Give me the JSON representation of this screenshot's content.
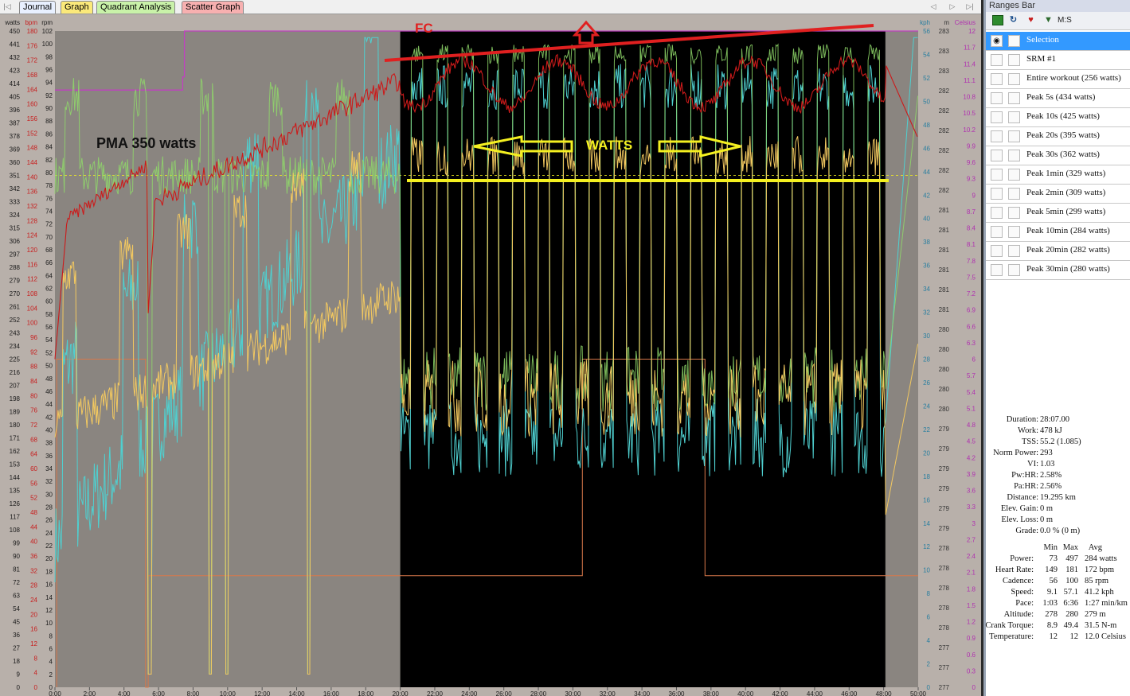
{
  "tabs": [
    "Journal",
    "Graph",
    "Quadrant Analysis",
    "Scatter Graph"
  ],
  "active_tab": "Graph",
  "nav_glyphs": [
    "|◁",
    "◁",
    "▷",
    "▷|"
  ],
  "axes": {
    "watts": {
      "label": "watts",
      "ticks": [
        "450",
        "441",
        "432",
        "423",
        "414",
        "405",
        "396",
        "387",
        "378",
        "369",
        "360",
        "351",
        "342",
        "333",
        "324",
        "315",
        "306",
        "297",
        "288",
        "279",
        "270",
        "261",
        "252",
        "243",
        "234",
        "225",
        "216",
        "207",
        "198",
        "189",
        "180",
        "171",
        "162",
        "153",
        "144",
        "135",
        "126",
        "117",
        "108",
        "99",
        "90",
        "81",
        "72",
        "63",
        "54",
        "45",
        "36",
        "27",
        "18",
        "9",
        "0"
      ]
    },
    "bpm": {
      "label": "bpm",
      "ticks": [
        "180",
        "176",
        "172",
        "168",
        "164",
        "160",
        "156",
        "152",
        "148",
        "144",
        "140",
        "136",
        "132",
        "128",
        "124",
        "120",
        "116",
        "112",
        "108",
        "104",
        "100",
        "96",
        "92",
        "88",
        "84",
        "80",
        "76",
        "72",
        "68",
        "64",
        "60",
        "56",
        "52",
        "48",
        "44",
        "40",
        "36",
        "32",
        "28",
        "24",
        "20",
        "16",
        "12",
        "8",
        "4",
        "0"
      ]
    },
    "rpm": {
      "label": "rpm",
      "ticks": [
        "102",
        "100",
        "98",
        "96",
        "94",
        "92",
        "90",
        "88",
        "86",
        "84",
        "82",
        "80",
        "78",
        "76",
        "74",
        "72",
        "70",
        "68",
        "66",
        "64",
        "62",
        "60",
        "58",
        "56",
        "54",
        "52",
        "50",
        "48",
        "46",
        "44",
        "42",
        "40",
        "38",
        "36",
        "34",
        "32",
        "30",
        "28",
        "26",
        "24",
        "22",
        "20",
        "18",
        "16",
        "14",
        "12",
        "10",
        "8",
        "6",
        "4",
        "2",
        "0"
      ]
    },
    "kph": {
      "label": "kph",
      "ticks": [
        "56",
        "54",
        "52",
        "50",
        "48",
        "46",
        "44",
        "42",
        "40",
        "38",
        "36",
        "34",
        "32",
        "30",
        "28",
        "26",
        "24",
        "22",
        "20",
        "18",
        "16",
        "14",
        "12",
        "10",
        "8",
        "6",
        "4",
        "2",
        "0"
      ]
    },
    "m": {
      "label": "m",
      "ticks": [
        "283",
        "283",
        "283",
        "282",
        "282",
        "282",
        "282",
        "282",
        "282",
        "281",
        "281",
        "281",
        "281",
        "281",
        "281",
        "280",
        "280",
        "280",
        "280",
        "280",
        "279",
        "279",
        "279",
        "279",
        "279",
        "279",
        "278",
        "278",
        "278",
        "278",
        "278",
        "277",
        "277",
        "277"
      ]
    },
    "celsius": {
      "label": "Celsius",
      "ticks": [
        "12",
        "11.7",
        "11.4",
        "11.1",
        "10.8",
        "10.5",
        "10.2",
        "9.9",
        "9.6",
        "9.3",
        "9",
        "8.7",
        "8.4",
        "8.1",
        "7.8",
        "7.5",
        "7.2",
        "6.9",
        "6.6",
        "6.3",
        "6",
        "5.7",
        "5.4",
        "5.1",
        "4.8",
        "4.5",
        "4.2",
        "3.9",
        "3.6",
        "3.3",
        "3",
        "2.7",
        "2.4",
        "2.1",
        "1.8",
        "1.5",
        "1.2",
        "0.9",
        "0.6",
        "0.3",
        "0"
      ]
    },
    "time": {
      "ticks": [
        "0:00",
        "2:00",
        "4:00",
        "6:00",
        "8:00",
        "10:00",
        "12:00",
        "14:00",
        "16:00",
        "18:00",
        "20:00",
        "22:00",
        "24:00",
        "26:00",
        "28:00",
        "30:00",
        "32:00",
        "34:00",
        "36:00",
        "38:00",
        "40:00",
        "42:00",
        "44:00",
        "46:00",
        "48:00",
        "50:00"
      ]
    }
  },
  "annotations": {
    "fc": "FC",
    "watts": "WATTS",
    "pma": "PMA 350 watts"
  },
  "chart_colors": {
    "heart_rate": "#cc1a1a",
    "speed": "#4fd0d0",
    "cadence": "#8fd86a",
    "power": "#f2c860",
    "altitude": "#d8784a",
    "temperature": "#c040c0",
    "annotation_red": "#e02020",
    "annotation_yellow": "#f4f020"
  },
  "ranges_bar": {
    "title": "Ranges Bar",
    "toolbar_label": "M:S",
    "items": [
      "Selection",
      "SRM #1",
      "Entire workout (256 watts)",
      "Peak 5s (434 watts)",
      "Peak 10s (425 watts)",
      "Peak 20s (395 watts)",
      "Peak 30s (362 watts)",
      "Peak 1min (329 watts)",
      "Peak 2min (309 watts)",
      "Peak 5min (299 watts)",
      "Peak 10min (284 watts)",
      "Peak 20min (282 watts)",
      "Peak 30min (280 watts)"
    ]
  },
  "summary": [
    {
      "k": "Duration:",
      "v": "28:07.00"
    },
    {
      "k": "Work:",
      "v": "478 kJ"
    },
    {
      "k": "TSS:",
      "v": "55.2 (1.085)"
    },
    {
      "k": "Norm Power:",
      "v": "293"
    },
    {
      "k": "VI:",
      "v": "1.03"
    },
    {
      "k": "Pw:HR:",
      "v": "2.58%"
    },
    {
      "k": "Pa:HR:",
      "v": "2.56%"
    },
    {
      "k": "Distance:",
      "v": "19.295 km"
    },
    {
      "k": "Elev. Gain:",
      "v": "0 m"
    },
    {
      "k": "Elev. Loss:",
      "v": "0 m"
    },
    {
      "k": "Grade:",
      "v": "0.0 % (0 m)"
    }
  ],
  "metrics_header": [
    "Min",
    "Max",
    "Avg"
  ],
  "metrics": [
    {
      "name": "Power:",
      "min": "73",
      "max": "497",
      "avg": "284 watts"
    },
    {
      "name": "Heart Rate:",
      "min": "149",
      "max": "181",
      "avg": "172 bpm"
    },
    {
      "name": "Cadence:",
      "min": "56",
      "max": "100",
      "avg": "85 rpm"
    },
    {
      "name": "Speed:",
      "min": "9.1",
      "max": "57.1",
      "avg": "41.2 kph"
    },
    {
      "name": "Pace:",
      "min": "1:03",
      "max": "6:36",
      "avg": "1:27 min/km"
    },
    {
      "name": "Altitude:",
      "min": "278",
      "max": "280",
      "avg": "279 m"
    },
    {
      "name": "Crank Torque:",
      "min": "8.9",
      "max": "49.4",
      "avg": "31.5 N-m"
    },
    {
      "name": "Temperature:",
      "min": "12",
      "max": "12",
      "avg": "12.0 Celsius"
    }
  ]
}
